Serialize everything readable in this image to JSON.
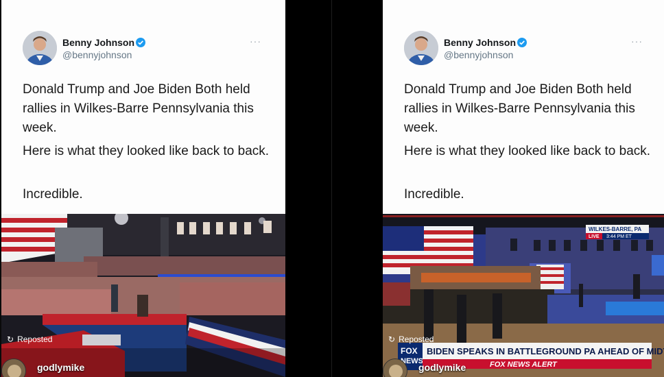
{
  "tweet": {
    "author": "Benny Johnson",
    "handle": "@bennyjohnson",
    "more_label": "···",
    "paragraph1": "Donald Trump and Joe Biden Both held rallies in Wilkes-Barre Pennsylvania this week.",
    "paragraph2": "Here is what they looked like back to back.",
    "paragraph3": "Incredible."
  },
  "overlay": {
    "repost_label": "Reposted",
    "username": "godlymike"
  },
  "fox": {
    "location": "WILKES-BARRE, PA",
    "live": "LIVE",
    "time": "3:44 PM ET",
    "logo_top": "FOX",
    "logo_bottom": "NEWS",
    "headline": "BIDEN SPEAKS IN BATTLEGROUND PA AHEAD OF MIDTERMS",
    "alert": "FOX NEWS ALERT"
  },
  "colors": {
    "verified": "#1d9bf0",
    "fox_red": "#c8102e",
    "fox_blue": "#0b2a6f"
  }
}
